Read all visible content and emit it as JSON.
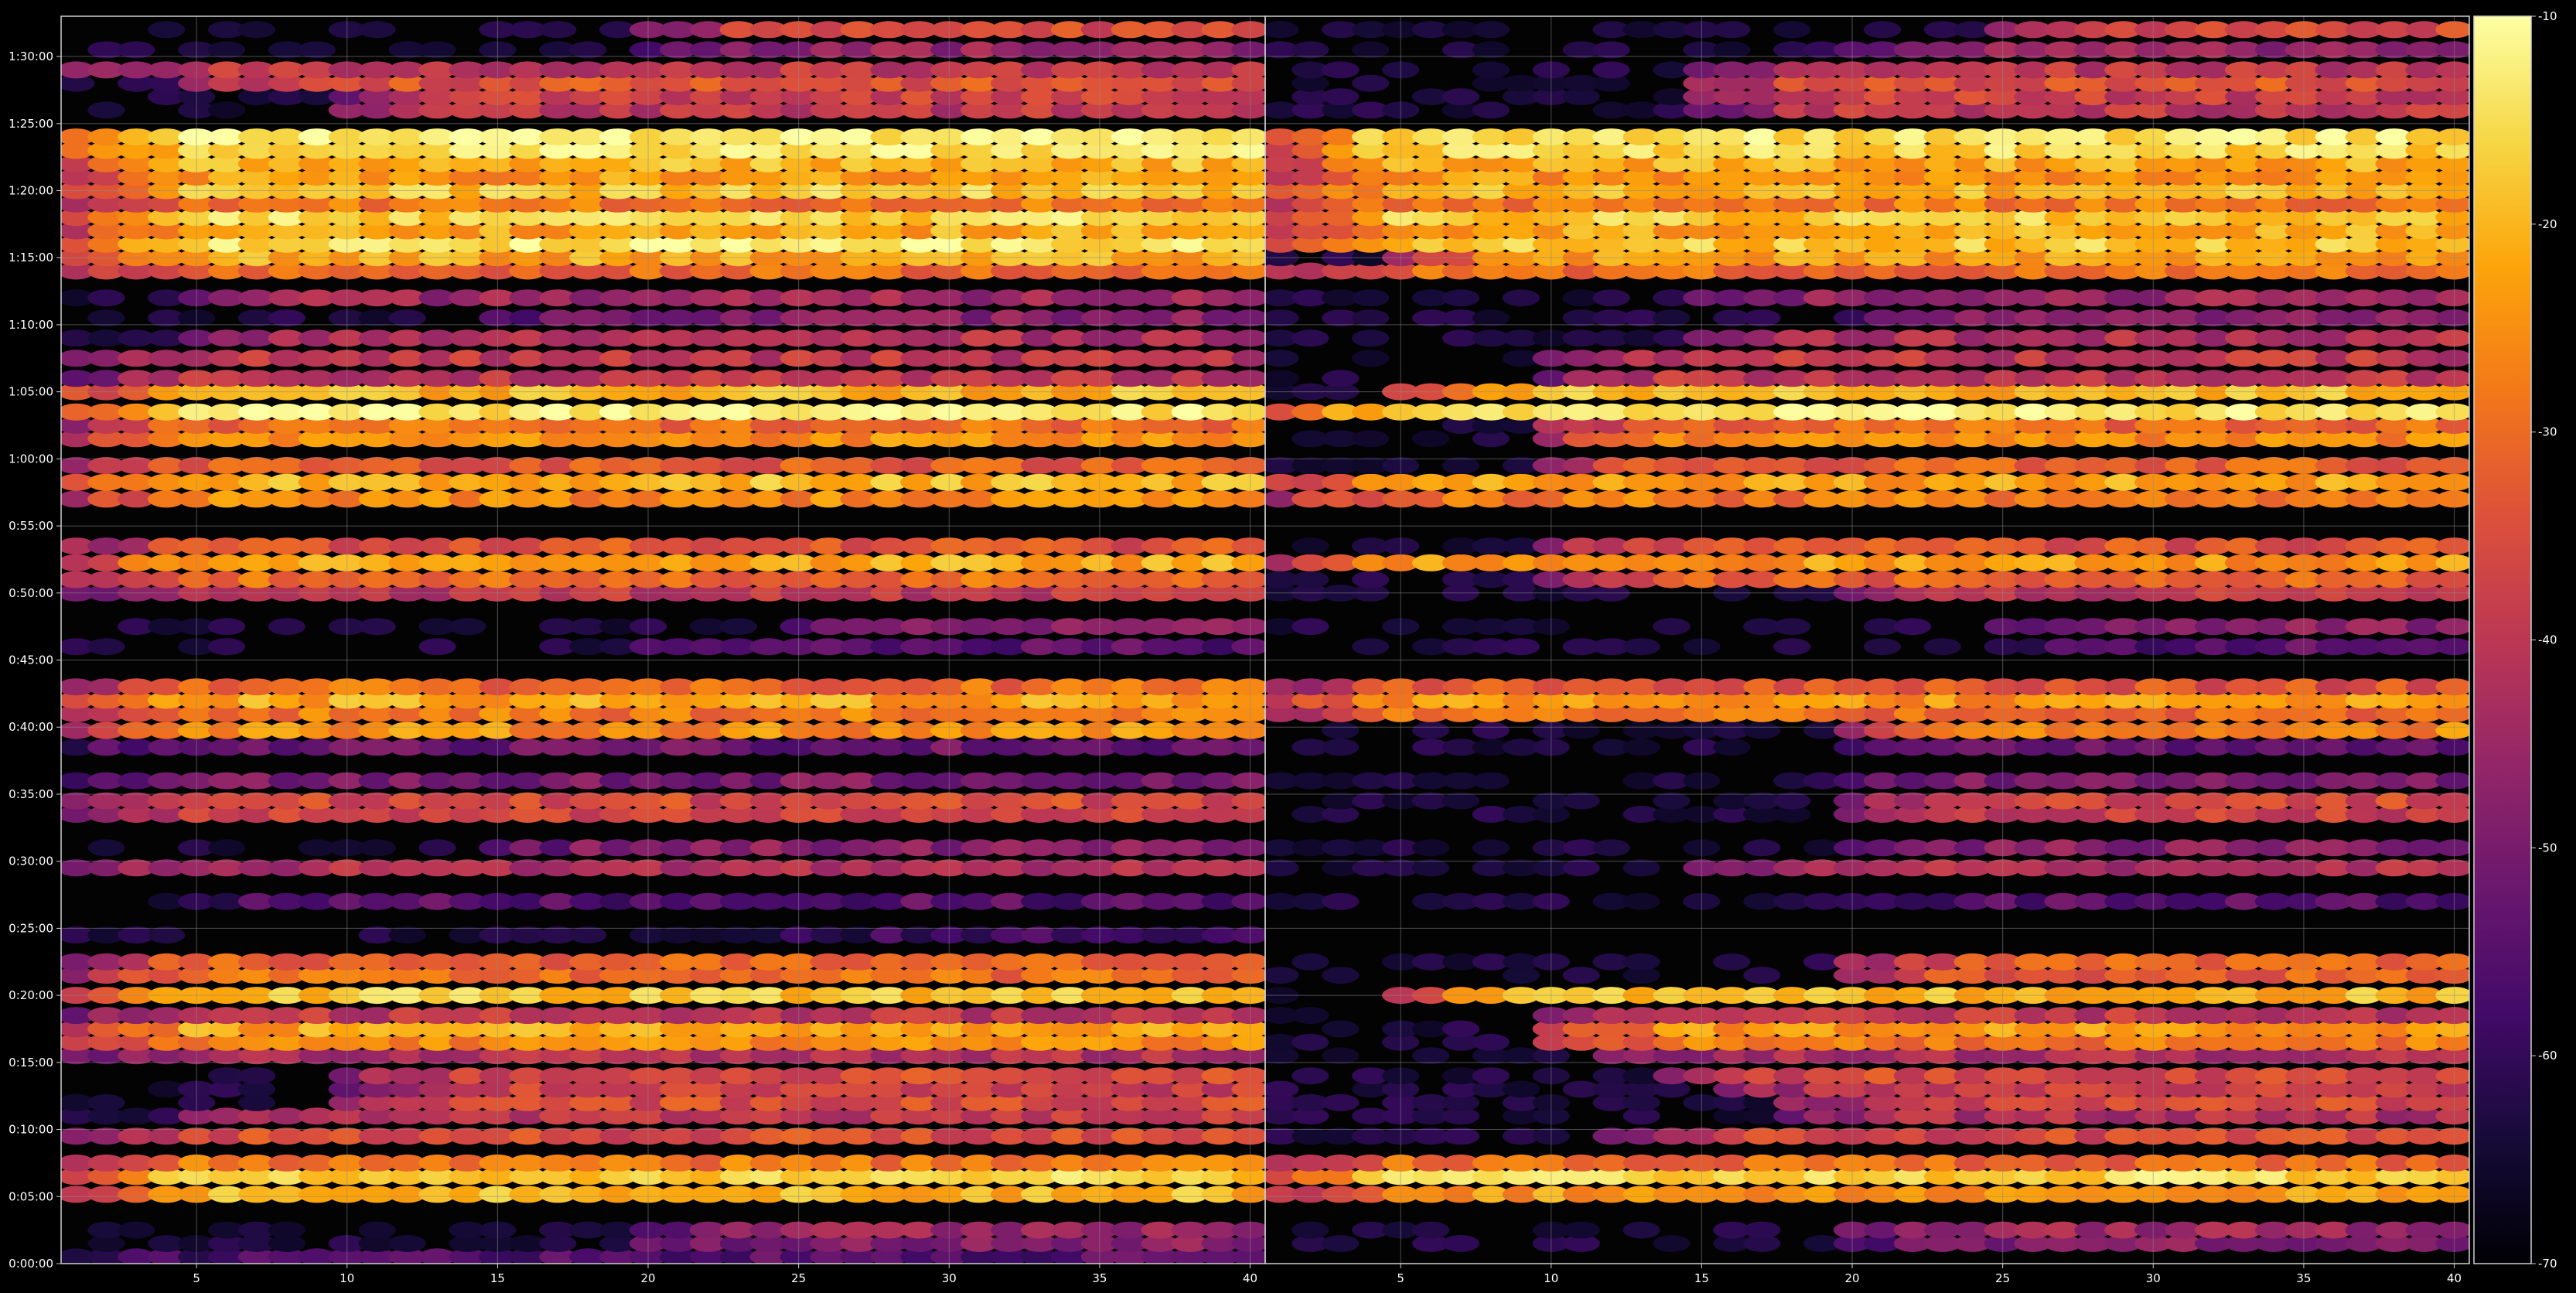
{
  "chart_data": [
    {
      "type": "heatmap",
      "panel": "left",
      "title": "",
      "xlabel": "",
      "ylabel": "",
      "xlim": [
        1,
        40
      ],
      "ylim_seconds": [
        0,
        5580
      ],
      "x_ticks": [
        5,
        10,
        15,
        20,
        25,
        30,
        35,
        40
      ],
      "y_ticks": [
        "0:00:00",
        "0:05:00",
        "0:10:00",
        "0:15:00",
        "0:20:00",
        "0:25:00",
        "0:30:00",
        "0:35:00",
        "0:40:00",
        "0:45:00",
        "0:50:00",
        "0:55:00",
        "1:00:00",
        "1:05:00",
        "1:10:00",
        "1:15:00",
        "1:20:00",
        "1:25:00",
        "1:30:00"
      ],
      "grid": true,
      "bands": [
        {
          "t": "0:00:30",
          "start": 3,
          "peak": -55
        },
        {
          "t": "0:01:30",
          "start": 20,
          "peak": -48
        },
        {
          "t": "0:02:30",
          "start": 20,
          "peak": -45
        },
        {
          "t": "0:05:10",
          "start": 1,
          "peak": -20
        },
        {
          "t": "0:06:30",
          "start": 1,
          "peak": -16
        },
        {
          "t": "0:07:30",
          "start": 1,
          "peak": -28
        },
        {
          "t": "0:09:30",
          "start": 1,
          "peak": -35
        },
        {
          "t": "0:11:00",
          "start": 5,
          "peak": -40
        },
        {
          "t": "0:12:00",
          "start": 10,
          "peak": -35
        },
        {
          "t": "0:13:00",
          "start": 10,
          "peak": -38
        },
        {
          "t": "0:14:00",
          "start": 10,
          "peak": -36
        },
        {
          "t": "0:15:30",
          "start": 1,
          "peak": -42
        },
        {
          "t": "0:16:30",
          "start": 1,
          "peak": -26
        },
        {
          "t": "0:17:30",
          "start": 1,
          "peak": -22
        },
        {
          "t": "0:18:30",
          "start": 1,
          "peak": -40
        },
        {
          "t": "0:20:00",
          "start": 1,
          "peak": -18
        },
        {
          "t": "0:21:30",
          "start": 1,
          "peak": -30
        },
        {
          "t": "0:22:30",
          "start": 1,
          "peak": -32
        },
        {
          "t": "0:24:30",
          "start": 25,
          "peak": -58
        },
        {
          "t": "0:27:00",
          "start": 5,
          "peak": -55
        },
        {
          "t": "0:29:30",
          "start": 1,
          "peak": -42
        },
        {
          "t": "0:31:00",
          "start": 15,
          "peak": -48
        },
        {
          "t": "0:33:30",
          "start": 1,
          "peak": -38
        },
        {
          "t": "0:34:30",
          "start": 1,
          "peak": -36
        },
        {
          "t": "0:36:00",
          "start": 1,
          "peak": -50
        },
        {
          "t": "0:38:30",
          "start": 1,
          "peak": -52
        },
        {
          "t": "0:39:45",
          "start": 1,
          "peak": -25
        },
        {
          "t": "0:41:00",
          "start": 1,
          "peak": -28
        },
        {
          "t": "0:42:00",
          "start": 1,
          "peak": -22
        },
        {
          "t": "0:43:00",
          "start": 1,
          "peak": -30
        },
        {
          "t": "0:46:00",
          "start": 20,
          "peak": -55
        },
        {
          "t": "0:47:30",
          "start": 25,
          "peak": -48
        },
        {
          "t": "0:50:00",
          "start": 1,
          "peak": -40
        },
        {
          "t": "0:51:00",
          "start": 1,
          "peak": -30
        },
        {
          "t": "0:52:15",
          "start": 1,
          "peak": -22
        },
        {
          "t": "0:53:30",
          "start": 1,
          "peak": -34
        },
        {
          "t": "0:57:00",
          "start": 1,
          "peak": -26
        },
        {
          "t": "0:58:15",
          "start": 1,
          "peak": -20
        },
        {
          "t": "0:59:30",
          "start": 1,
          "peak": -32
        },
        {
          "t": "1:01:30",
          "start": 1,
          "peak": -25
        },
        {
          "t": "1:02:30",
          "start": 1,
          "peak": -30
        },
        {
          "t": "1:03:30",
          "start": 1,
          "peak": -13
        },
        {
          "t": "1:05:00",
          "start": 1,
          "peak": -20
        },
        {
          "t": "1:06:00",
          "start": 1,
          "peak": -40
        },
        {
          "t": "1:07:30",
          "start": 1,
          "peak": -40
        },
        {
          "t": "1:09:00",
          "start": 5,
          "peak": -42
        },
        {
          "t": "1:10:30",
          "start": 15,
          "peak": -48
        },
        {
          "t": "1:12:00",
          "start": 5,
          "peak": -45
        },
        {
          "t": "1:14:00",
          "start": 1,
          "peak": -30
        },
        {
          "t": "1:15:00",
          "start": 1,
          "peak": -22
        },
        {
          "t": "1:16:00",
          "start": 1,
          "peak": -14
        },
        {
          "t": "1:17:00",
          "start": 1,
          "peak": -22
        },
        {
          "t": "1:18:00",
          "start": 1,
          "peak": -16
        },
        {
          "t": "1:19:00",
          "start": 1,
          "peak": -28
        },
        {
          "t": "1:20:00",
          "start": 1,
          "peak": -18
        },
        {
          "t": "1:21:00",
          "start": 1,
          "peak": -24
        },
        {
          "t": "1:22:00",
          "start": 1,
          "peak": -20
        },
        {
          "t": "1:23:00",
          "start": 1,
          "peak": -14
        },
        {
          "t": "1:24:00",
          "start": 1,
          "peak": -12
        },
        {
          "t": "1:26:00",
          "start": 10,
          "peak": -40
        },
        {
          "t": "1:27:00",
          "start": 10,
          "peak": -38
        },
        {
          "t": "1:28:00",
          "start": 5,
          "peak": -34
        },
        {
          "t": "1:29:00",
          "start": 1,
          "peak": -40
        },
        {
          "t": "1:30:30",
          "start": 20,
          "peak": -46
        },
        {
          "t": "1:32:00",
          "start": 20,
          "peak": -36
        }
      ]
    },
    {
      "type": "heatmap",
      "panel": "right",
      "title": "",
      "xlabel": "",
      "ylabel": "",
      "xlim": [
        1,
        40
      ],
      "ylim_seconds": [
        0,
        5580
      ],
      "x_ticks": [
        5,
        10,
        15,
        20,
        25,
        30,
        35,
        40
      ],
      "grid": true,
      "bands": [
        {
          "t": "0:01:30",
          "start": 20,
          "peak": -48
        },
        {
          "t": "0:02:30",
          "start": 20,
          "peak": -45
        },
        {
          "t": "0:05:10",
          "start": 1,
          "peak": -24
        },
        {
          "t": "0:06:30",
          "start": 1,
          "peak": -16
        },
        {
          "t": "0:07:30",
          "start": 1,
          "peak": -30
        },
        {
          "t": "0:09:30",
          "start": 12,
          "peak": -36
        },
        {
          "t": "0:11:00",
          "start": 18,
          "peak": -42
        },
        {
          "t": "0:12:00",
          "start": 18,
          "peak": -36
        },
        {
          "t": "0:13:00",
          "start": 16,
          "peak": -38
        },
        {
          "t": "0:14:00",
          "start": 14,
          "peak": -36
        },
        {
          "t": "0:15:30",
          "start": 12,
          "peak": -42
        },
        {
          "t": "0:16:30",
          "start": 10,
          "peak": -28
        },
        {
          "t": "0:17:30",
          "start": 10,
          "peak": -24
        },
        {
          "t": "0:18:30",
          "start": 10,
          "peak": -40
        },
        {
          "t": "0:20:00",
          "start": 5,
          "peak": -20
        },
        {
          "t": "0:21:30",
          "start": 20,
          "peak": -32
        },
        {
          "t": "0:22:30",
          "start": 20,
          "peak": -32
        },
        {
          "t": "0:27:00",
          "start": 20,
          "peak": -55
        },
        {
          "t": "0:29:30",
          "start": 15,
          "peak": -42
        },
        {
          "t": "0:31:00",
          "start": 20,
          "peak": -48
        },
        {
          "t": "0:33:30",
          "start": 20,
          "peak": -38
        },
        {
          "t": "0:34:30",
          "start": 20,
          "peak": -36
        },
        {
          "t": "0:36:00",
          "start": 20,
          "peak": -50
        },
        {
          "t": "0:38:30",
          "start": 20,
          "peak": -52
        },
        {
          "t": "0:39:45",
          "start": 20,
          "peak": -26
        },
        {
          "t": "0:41:00",
          "start": 1,
          "peak": -30
        },
        {
          "t": "0:42:00",
          "start": 1,
          "peak": -24
        },
        {
          "t": "0:43:00",
          "start": 1,
          "peak": -34
        },
        {
          "t": "0:46:00",
          "start": 25,
          "peak": -55
        },
        {
          "t": "0:47:30",
          "start": 25,
          "peak": -48
        },
        {
          "t": "0:50:00",
          "start": 20,
          "peak": -40
        },
        {
          "t": "0:51:00",
          "start": 10,
          "peak": -32
        },
        {
          "t": "0:52:15",
          "start": 1,
          "peak": -24
        },
        {
          "t": "0:53:30",
          "start": 10,
          "peak": -34
        },
        {
          "t": "0:57:00",
          "start": 1,
          "peak": -28
        },
        {
          "t": "0:58:15",
          "start": 1,
          "peak": -22
        },
        {
          "t": "0:59:30",
          "start": 10,
          "peak": -32
        },
        {
          "t": "1:01:30",
          "start": 10,
          "peak": -26
        },
        {
          "t": "1:02:30",
          "start": 10,
          "peak": -30
        },
        {
          "t": "1:03:30",
          "start": 1,
          "peak": -14
        },
        {
          "t": "1:05:00",
          "start": 5,
          "peak": -20
        },
        {
          "t": "1:06:00",
          "start": 10,
          "peak": -40
        },
        {
          "t": "1:07:30",
          "start": 10,
          "peak": -40
        },
        {
          "t": "1:09:00",
          "start": 15,
          "peak": -42
        },
        {
          "t": "1:10:30",
          "start": 20,
          "peak": -48
        },
        {
          "t": "1:12:00",
          "start": 15,
          "peak": -45
        },
        {
          "t": "1:14:00",
          "start": 1,
          "peak": -30
        },
        {
          "t": "1:15:00",
          "start": 5,
          "peak": -24
        },
        {
          "t": "1:16:00",
          "start": 1,
          "peak": -18
        },
        {
          "t": "1:17:00",
          "start": 1,
          "peak": -22
        },
        {
          "t": "1:18:00",
          "start": 1,
          "peak": -18
        },
        {
          "t": "1:19:00",
          "start": 1,
          "peak": -28
        },
        {
          "t": "1:20:00",
          "start": 1,
          "peak": -20
        },
        {
          "t": "1:21:00",
          "start": 1,
          "peak": -24
        },
        {
          "t": "1:22:00",
          "start": 1,
          "peak": -22
        },
        {
          "t": "1:23:00",
          "start": 1,
          "peak": -16
        },
        {
          "t": "1:24:00",
          "start": 1,
          "peak": -14
        },
        {
          "t": "1:26:00",
          "start": 15,
          "peak": -40
        },
        {
          "t": "1:27:00",
          "start": 15,
          "peak": -38
        },
        {
          "t": "1:28:00",
          "start": 15,
          "peak": -34
        },
        {
          "t": "1:29:00",
          "start": 15,
          "peak": -40
        },
        {
          "t": "1:30:30",
          "start": 20,
          "peak": -46
        },
        {
          "t": "1:32:00",
          "start": 25,
          "peak": -36
        }
      ]
    },
    {
      "type": "colorbar",
      "cmap": "inferno",
      "range": [
        -70,
        -10
      ],
      "ticks": [
        -10,
        -20,
        -30,
        -40,
        -50,
        -60,
        -70
      ]
    }
  ],
  "colors": {
    "background": "#000000",
    "axes_face": "#030303",
    "spine": "#cfcfcf",
    "grid": "#8a8a8a",
    "text": "#ffffff"
  }
}
